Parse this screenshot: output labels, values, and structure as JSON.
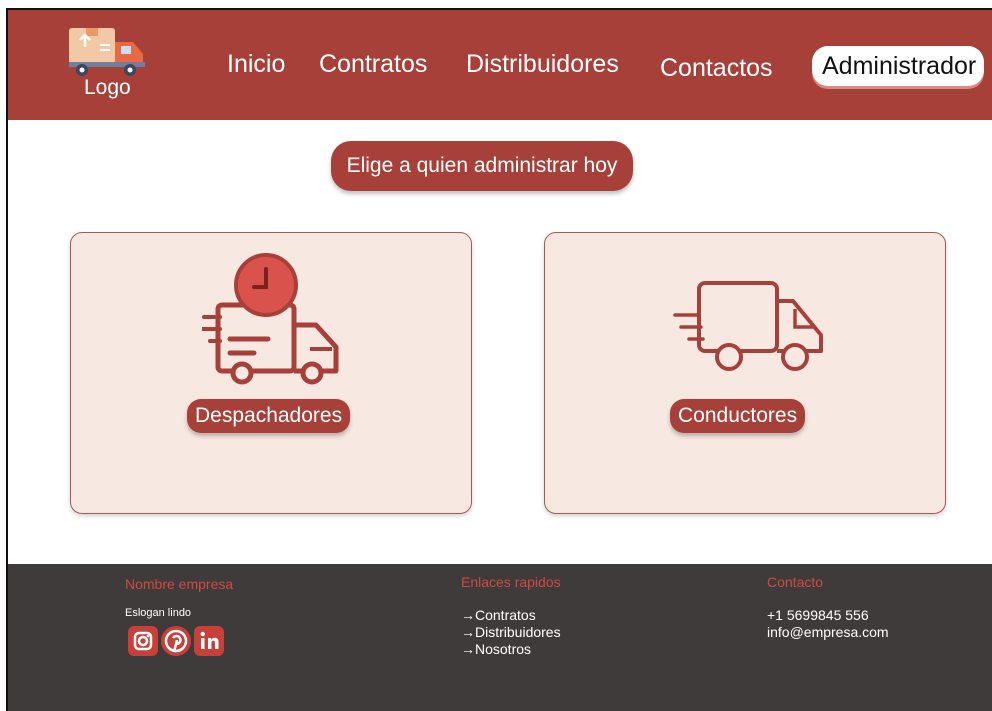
{
  "header": {
    "logo_text": "Logo",
    "nav": [
      "Inicio",
      "Contratos",
      "Distribuidores",
      "Contactos"
    ],
    "admin_label": "Administrador"
  },
  "main": {
    "title": "Elige a quien administrar hoy",
    "cards": [
      {
        "label": "Despachadores",
        "icon": "fast-truck-clock-icon"
      },
      {
        "label": "Conductores",
        "icon": "delivery-truck-icon"
      }
    ]
  },
  "footer": {
    "company_heading": "Nombre empresa",
    "slogan": "Eslogan lindo",
    "social": [
      "instagram-icon",
      "pinterest-icon",
      "linkedin-icon"
    ],
    "links_heading": "Enlaces rapidos",
    "links": [
      "→Contratos",
      "→Distribuidores",
      "→Nosotros"
    ],
    "contact_heading": "Contacto",
    "phone": "+1 5699845 556",
    "email": "info@empresa.com"
  },
  "colors": {
    "brand": "#a8403a",
    "card_bg": "#f8e8e2",
    "footer_bg": "#3f3b3b",
    "footer_heading": "#cf4a43"
  }
}
